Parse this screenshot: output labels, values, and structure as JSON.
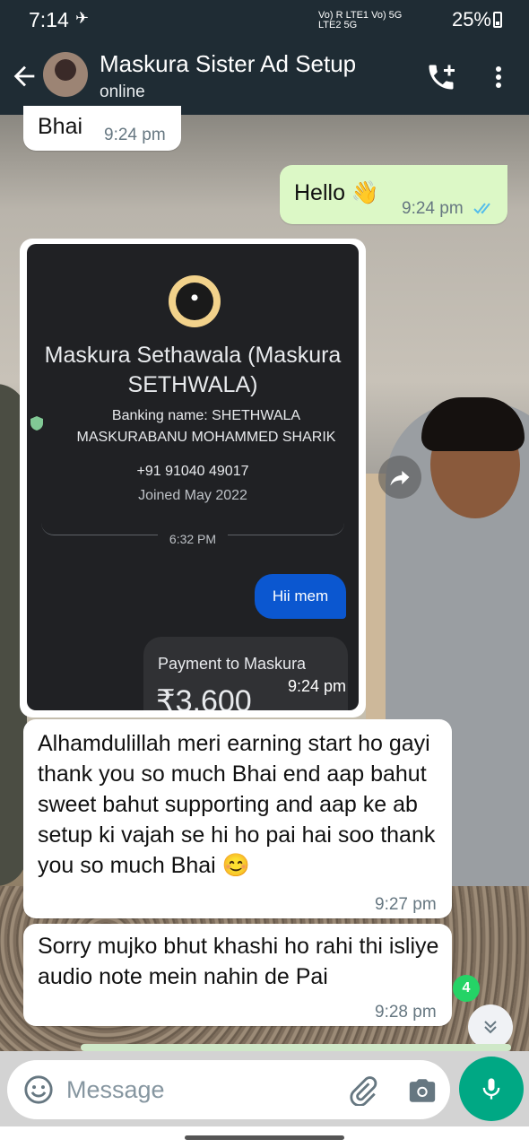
{
  "status_bar": {
    "time": "7:14",
    "battery": "25%",
    "network_labels": "Vo) R LTE1 Vo) 5G LTE2 5G"
  },
  "header": {
    "title": "Maskura Sister Ad Setup",
    "subtitle": "online"
  },
  "messages": [
    {
      "direction": "in",
      "text": "Bhai",
      "time": "9:24 pm"
    },
    {
      "direction": "out",
      "text": "Hello 👋",
      "time": "9:24 pm",
      "status": "read"
    },
    {
      "direction": "in",
      "type": "image",
      "time": "9:24 pm",
      "image": {
        "contact_name": "Maskura Sethawala (Maskura SETHWALA)",
        "banking_name": "Banking name: SHETHWALA MASKURABANU MOHAMMED SHARIK",
        "phone": "+91 91040 49017",
        "joined": "Joined May 2022",
        "divider_time": "6:32 PM",
        "chat_message": "Hii mem",
        "payment_label": "Payment to Maskura",
        "payment_amount": "₹3,600"
      }
    },
    {
      "direction": "in",
      "text": "Alhamdulillah meri earning start ho gayi thank you so much Bhai end aap bahut sweet bahut supporting and aap ke ab setup ki vajah se hi ho pai hai soo thank you so much Bhai 😊",
      "time": "9:27 pm"
    },
    {
      "direction": "in",
      "text": "Sorry mujko bhut khashi ho rahi thi isliye audio note mein nahin de Pai",
      "time": "9:28 pm"
    }
  ],
  "unread_badge": "4",
  "composer": {
    "placeholder": "Message"
  },
  "colors": {
    "header_bg": "#1f2c34",
    "outgoing_bubble": "#dcf8c6",
    "accent_green": "#00a884",
    "read_ticks": "#53bdeb"
  },
  "icons": [
    "back-arrow-icon",
    "add-call-icon",
    "more-vert-icon",
    "forward-icon",
    "double-check-icon",
    "chevron-double-down-icon",
    "emoji-icon",
    "attach-icon",
    "camera-icon",
    "mic-icon"
  ]
}
